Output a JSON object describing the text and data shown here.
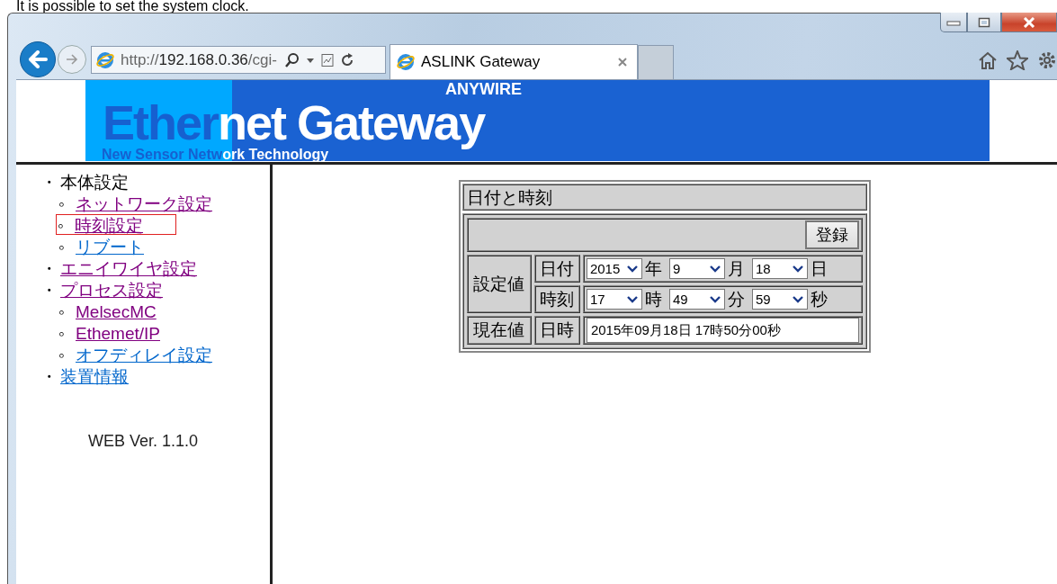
{
  "caption": "It is possible to set the system clock.",
  "browser": {
    "address": {
      "scheme": "http://",
      "host": "192.168.0.36",
      "path": "/cgi-"
    },
    "tab": {
      "title": "ASLINK Gateway"
    }
  },
  "banner": {
    "title": [
      {
        "text": "Ether",
        "color": "#1660d0"
      },
      {
        "text": "net Gateway",
        "color": "#ffffff"
      }
    ],
    "brand": "ANYWIRE",
    "tagline": [
      {
        "text": "New Sensor Netw",
        "color": "#1660d0"
      },
      {
        "text": "ork Technology",
        "color": "#ffffff"
      }
    ]
  },
  "sidebar": {
    "items": [
      {
        "bullet": "・",
        "label": "本体設定",
        "link": false,
        "selected": false,
        "children": [
          {
            "bullet": "◦",
            "label": "ネットワーク設定",
            "link": true,
            "visited": true,
            "selected": false
          },
          {
            "bullet": "◦",
            "label": "時刻設定",
            "link": true,
            "visited": true,
            "selected": true
          },
          {
            "bullet": "◦",
            "label": "リブート",
            "link": true,
            "visited": false,
            "selected": false
          }
        ]
      },
      {
        "bullet": "・",
        "label": "エニイワイヤ設定",
        "link": true,
        "visited": true,
        "selected": false
      },
      {
        "bullet": "・",
        "label": "プロセス設定",
        "link": true,
        "visited": true,
        "selected": false,
        "children": [
          {
            "bullet": "◦",
            "label": "MelsecMC",
            "link": true,
            "visited": true,
            "selected": false
          },
          {
            "bullet": "◦",
            "label": "Ethemet/IP",
            "link": true,
            "visited": true,
            "selected": false
          },
          {
            "bullet": "◦",
            "label": "オフディレイ設定",
            "link": true,
            "visited": false,
            "selected": false
          }
        ]
      },
      {
        "bullet": "・",
        "label": "装置情報",
        "link": true,
        "visited": false,
        "selected": false
      }
    ],
    "version": "WEB Ver. 1.1.0"
  },
  "form": {
    "title": "日付と時刻",
    "register_button": "登録",
    "set_group": "設定値",
    "set_rows": [
      {
        "label": "日付",
        "fields": [
          {
            "value": "2015",
            "unit": "年"
          },
          {
            "value": "9",
            "unit": "月"
          },
          {
            "value": "18",
            "unit": "日"
          }
        ]
      },
      {
        "label": "時刻",
        "fields": [
          {
            "value": "17",
            "unit": "時"
          },
          {
            "value": "49",
            "unit": "分"
          },
          {
            "value": "59",
            "unit": "秒"
          }
        ]
      }
    ],
    "current_group": "現在値",
    "current_label": "日時",
    "current_value": "2015年09月18日 17時50分00秒"
  }
}
